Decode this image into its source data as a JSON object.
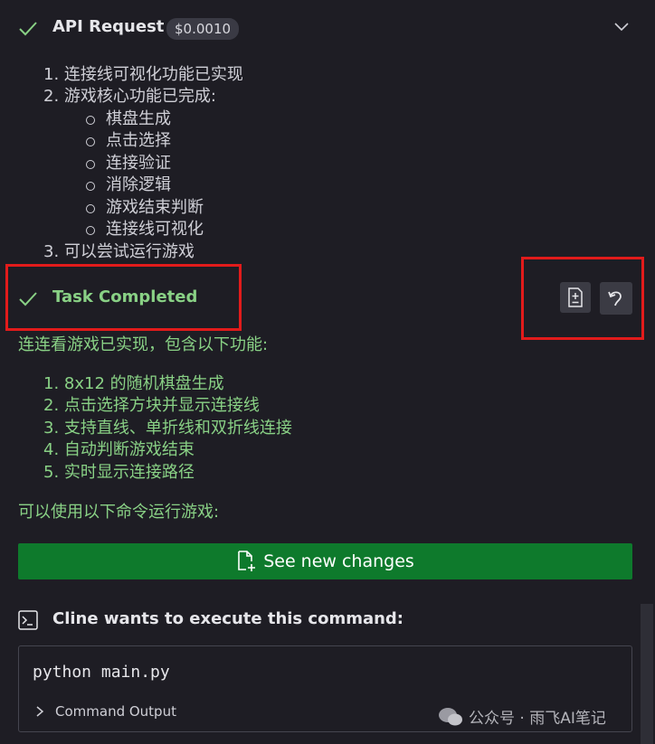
{
  "api_request": {
    "title": "API Request",
    "cost": "$0.0010",
    "list": [
      "1. 连接线可视化功能已实现",
      "2. 游戏核心功能已完成:",
      "3. 可以尝试运行游戏"
    ],
    "sublist": [
      "棋盘生成",
      "点击选择",
      "连接验证",
      "消除逻辑",
      "游戏结束判断",
      "连接线可视化"
    ]
  },
  "task": {
    "title": "Task Completed",
    "intro": "连连看游戏已实现，包含以下功能:",
    "features": [
      "1. 8x12 的随机棋盘生成",
      "2. 点击选择方块并显示连接线",
      "3. 支持直线、单折线和双折线连接",
      "4. 自动判断游戏结束",
      "5. 实时显示连接路径"
    ],
    "run_hint": "可以使用以下命令运行游戏:"
  },
  "see_changes_label": "See new changes",
  "command_section": {
    "title": "Cline wants to execute this command:",
    "command": "python main.py",
    "output_label": "Command Output"
  },
  "watermark": "公众号 · 雨飞AI笔记",
  "colors": {
    "accent_green": "#89d185",
    "button_green": "#0e7a2c",
    "annotation_red": "#e21b1b"
  }
}
